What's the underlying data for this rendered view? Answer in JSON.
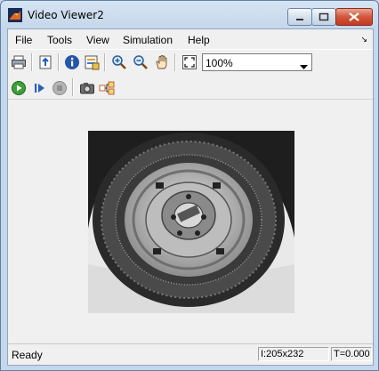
{
  "window": {
    "title": "Video Viewer2"
  },
  "menu": {
    "items": [
      "File",
      "Tools",
      "View",
      "Simulation",
      "Help"
    ],
    "overflow_glyph": "↘"
  },
  "toolbar": {
    "icons": [
      "print-icon",
      "open-file-icon",
      "info-icon",
      "properties-icon",
      "zoom-in-icon",
      "zoom-out-icon",
      "pan-hand-icon",
      "fit-to-window-icon"
    ],
    "zoom": {
      "value": "100%"
    }
  },
  "sim_toolbar": {
    "icons": [
      "run-icon",
      "step-forward-icon",
      "stop-icon",
      "snapshot-icon",
      "highlight-block-icon"
    ]
  },
  "status": {
    "text": "Ready",
    "image_size": "I:205x232",
    "time": "T=0.000"
  },
  "colors": {
    "titlebar": "#c5d7ea",
    "close_button": "#c23b22",
    "client_background": "#f0f0f0"
  }
}
